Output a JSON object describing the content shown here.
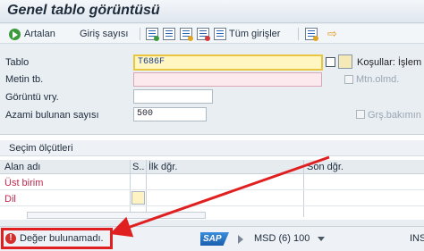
{
  "window": {
    "title": "Genel tablo görüntüsü"
  },
  "toolbar": {
    "execute_label": "Artalan",
    "count_label": "Giriş sayısı",
    "all_entries_label": "Tüm girişler"
  },
  "form": {
    "table_label": "Tablo",
    "table_value": "T686F",
    "text_table_label": "Metin tb.",
    "text_table_value": "",
    "view_label": "Görüntü vry.",
    "view_value": "",
    "max_hits_label": "Azami bulunan sayısı",
    "max_hits_value": "500",
    "conditions_label": "Koşullar: İşlem",
    "check_mtn_label": "Mtn.olmd.",
    "check_grs_label": "Grş.bakımın"
  },
  "criteria": {
    "section_title": "Seçim ölçütleri",
    "columns": [
      "Alan adı",
      "S..",
      "İlk dğr.",
      "Son dğr."
    ],
    "rows": [
      {
        "name": "Üst birim"
      },
      {
        "name": "Dil"
      }
    ]
  },
  "status": {
    "message": "Değer bulunamadı.",
    "system": "MSD (6) 100",
    "mode": "INS",
    "logo_text": "SAP"
  },
  "colors": {
    "error": "#d62d2d",
    "required_field": "#fbe9ee",
    "active_field": "#fff6c2",
    "annotation": "#e02020"
  }
}
